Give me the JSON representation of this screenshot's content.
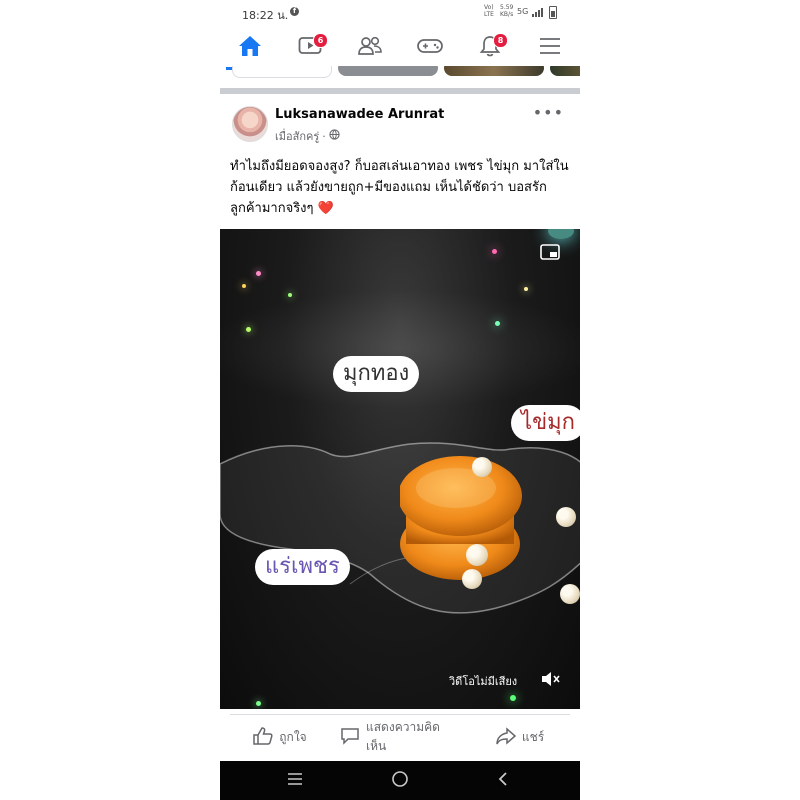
{
  "status_bar": {
    "time": "18:22 น.",
    "network_top": "Vo)",
    "network_bottom": "LTE",
    "speed_top": "5.59",
    "speed_bottom": "KB/s",
    "network_type": "5G"
  },
  "nav": {
    "tabs": [
      {
        "name": "home",
        "icon": "home-icon",
        "active": true,
        "badge": ""
      },
      {
        "name": "watch",
        "icon": "video-icon",
        "active": false,
        "badge": "6"
      },
      {
        "name": "friends",
        "icon": "friends-icon",
        "active": false,
        "badge": ""
      },
      {
        "name": "gaming",
        "icon": "gamepad-icon",
        "active": false,
        "badge": ""
      },
      {
        "name": "notifications",
        "icon": "bell-icon",
        "active": false,
        "badge": "8"
      },
      {
        "name": "menu",
        "icon": "hamburger-icon",
        "active": false,
        "badge": ""
      }
    ],
    "accent": "#1877f2",
    "badge_color": "#e41e3f"
  },
  "post": {
    "author": "Luksanawadee Arunrat",
    "timestamp": "เมื่อสักครู่",
    "separator": "·",
    "caption": "ทำไมถึงมียอดจองสูง? ก็บอสเล่นเอาทอง เพชร ไข่มุก มาใส่ในก้อนเดียว แล้วยังขายถูก+มีของแถม เห็นได้ชัดว่า บอสรักลูกค้ามากจริงๆ",
    "caption_emoji": "❤️"
  },
  "video": {
    "labels": {
      "gold": "มุกทอง",
      "pearl": "ไข่มุก",
      "diamond": "แร่เพชร"
    },
    "mute_text": "วิดีโอไม่มีเสียง"
  },
  "actions": {
    "like": "ถูกใจ",
    "comment": "แสดงความคิดเห็น",
    "share": "แชร์"
  }
}
